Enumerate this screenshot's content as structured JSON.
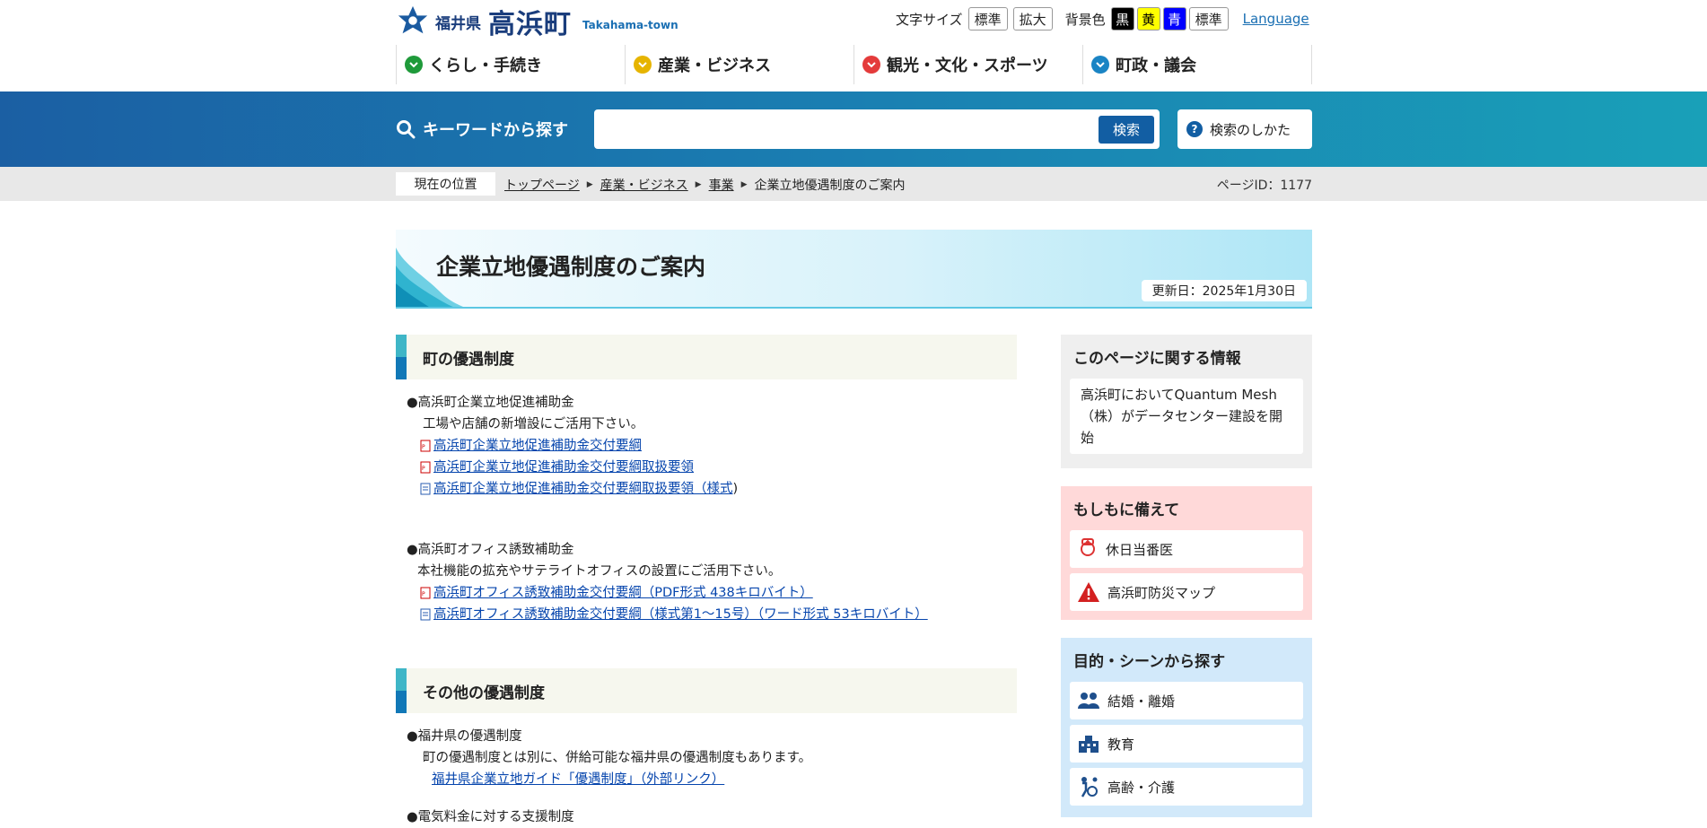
{
  "header": {
    "logo": {
      "pref": "福井県",
      "town": "高浜町",
      "en": "Takahama-town"
    },
    "font_size": {
      "label": "文字サイズ",
      "standard": "標準",
      "enlarge": "拡大"
    },
    "bg_color": {
      "label": "背景色",
      "black": "黒",
      "yellow": "黄",
      "blue": "青",
      "standard": "標準"
    },
    "language": "Language",
    "nav": [
      {
        "label": "くらし・手続き",
        "color": "#1f9a3a"
      },
      {
        "label": "産業・ビジネス",
        "color": "#e6b400"
      },
      {
        "label": "観光・文化・スポーツ",
        "color": "#e43b3b"
      },
      {
        "label": "町政・議会",
        "color": "#1a84c4"
      }
    ]
  },
  "search": {
    "label": "キーワードから探す",
    "placeholder": "",
    "button": "検索",
    "howto": "検索のしかた"
  },
  "breadcrumb": {
    "current_label": "現在の位置",
    "items": [
      "トップページ",
      "産業・ビジネス",
      "事業",
      "企業立地優遇制度のご案内"
    ],
    "page_id": "ページID：1177"
  },
  "page": {
    "title": "企業立地優遇制度のご案内",
    "updated": "更新日：2025年1月30日"
  },
  "sections": [
    {
      "heading": "町の優遇制度",
      "groups": [
        {
          "title": "●高浜町企業立地促進補助金",
          "desc": "工場や店舗の新増設にご活用下さい。",
          "files": [
            {
              "type": "pdf",
              "text": "高浜町企業立地促進補助金交付要綱"
            },
            {
              "type": "pdf",
              "text": "高浜町企業立地促進補助金交付要綱取扱要領"
            },
            {
              "type": "word",
              "text": "高浜町企業立地促進補助金交付要綱取扱要領（様式",
              "suffix": ")"
            }
          ]
        },
        {
          "title": "●高浜町オフィス誘致補助金",
          "desc": "本社機能の拡充やサテライトオフィスの設置にご活用下さい。",
          "files": [
            {
              "type": "pdf",
              "text": "高浜町オフィス誘致補助金交付要綱（PDF形式 438キロバイト）"
            },
            {
              "type": "word",
              "text": "高浜町オフィス誘致補助金交付要綱（様式第1～15号）（ワード形式 53キロバイト）"
            }
          ]
        }
      ]
    },
    {
      "heading": "その他の優遇制度",
      "groups": [
        {
          "title": "●福井県の優遇制度",
          "desc": "町の優遇制度とは別に、併給可能な福井県の優遇制度もあります。",
          "link": "福井県企業立地ガイド「優遇制度」（外部リンク）"
        },
        {
          "title": "●電気料金に対する支援制度"
        }
      ]
    }
  ],
  "sidebar": {
    "info": {
      "heading": "このページに関する情報",
      "text": "高浜町においてQuantum Mesh（株）がデータセンター建設を開始"
    },
    "emergency": {
      "heading": "もしもに備えて",
      "items": [
        "休日当番医",
        "高浜町防災マップ"
      ]
    },
    "scenes": {
      "heading": "目的・シーンから探す",
      "items": [
        "結婚・離婚",
        "教育",
        "高齢・介護"
      ]
    }
  },
  "colors": {
    "brand": "#1a3d7c",
    "search_band": "#1a7fb2",
    "section_bar_top": "#3fb6c7",
    "section_bar_bottom": "#1178b7",
    "emergency_bg": "#ffd9d9",
    "scene_bg": "#d2e9fa",
    "info_bg": "#efefef"
  }
}
